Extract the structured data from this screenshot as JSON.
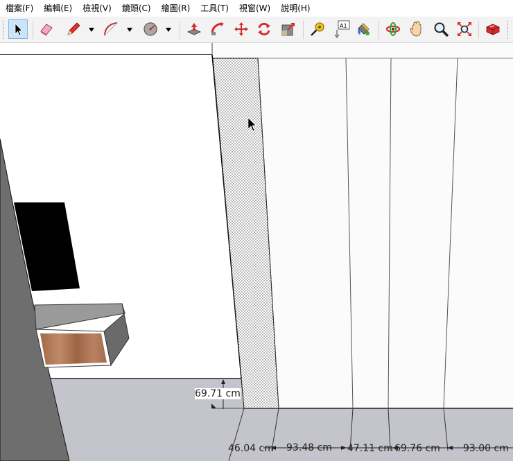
{
  "menu": {
    "items": [
      {
        "id": "file",
        "label": "檔案(F)"
      },
      {
        "id": "edit",
        "label": "編輯(E)"
      },
      {
        "id": "view",
        "label": "檢視(V)"
      },
      {
        "id": "camera",
        "label": "鏡頭(C)"
      },
      {
        "id": "draw",
        "label": "繪圖(R)"
      },
      {
        "id": "tools",
        "label": "工具(T)"
      },
      {
        "id": "window",
        "label": "視窗(W)"
      },
      {
        "id": "help",
        "label": "說明(H)"
      }
    ]
  },
  "toolbar": {
    "active_tool": "select-tool",
    "tools": [
      "select-icon",
      "eraser-icon",
      "pencil-icon",
      "arc-icon",
      "circle-icon",
      "push-pull-icon",
      "follow-me-icon",
      "move-icon",
      "rotate-icon",
      "scale-icon",
      "tape-measure-icon",
      "text-icon",
      "paint-bucket-icon",
      "orbit-icon",
      "pan-icon",
      "zoom-icon",
      "zoom-extents-icon",
      "components-icon"
    ],
    "text_tool_label": "A1"
  },
  "viewport": {
    "dimensions": {
      "vertical": "69.71 cm",
      "d1": "46.04 cm",
      "d2": "93.48 cm",
      "d3": "47.11 cm",
      "d4": "69.76 cm",
      "d5": "93.00 cm"
    }
  },
  "colors": {
    "wall_gray": "#6e6e6e",
    "floor_gray": "#c4c4cc",
    "tv_black": "#000000",
    "wood": "#b07a58",
    "cabinet_gray": "#9a9a9a",
    "selection_blue": "#cce4f7",
    "accent_red": "#d42a2a"
  }
}
